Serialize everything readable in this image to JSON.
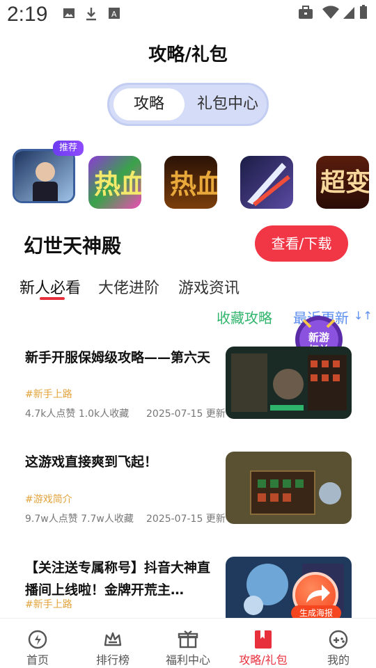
{
  "status": {
    "time": "2:19"
  },
  "header": {
    "title": "攻略/礼包"
  },
  "segment": {
    "active": "攻略",
    "inactive": "礼包中心"
  },
  "games": {
    "badge": "推荐",
    "icons": [
      {
        "name": "game-icon-1",
        "color1": "#2c4a7a",
        "color2": "#9fc3ee"
      },
      {
        "name": "game-icon-2",
        "color1": "#2a6b2f",
        "color2": "#e94fd0"
      },
      {
        "name": "game-icon-3",
        "color1": "#3a1a08",
        "color2": "#d89a2b"
      },
      {
        "name": "game-icon-4",
        "color1": "#2b2d5b",
        "color2": "#e6e6f2"
      },
      {
        "name": "game-icon-5",
        "color1": "#4b1a0c",
        "color2": "#f3c98f"
      }
    ]
  },
  "game": {
    "name": "幻世天神殿",
    "download": "查看/下载"
  },
  "tabs": [
    "新人必看",
    "大佬进阶",
    "游戏资讯"
  ],
  "sort": {
    "fav": "收藏攻略",
    "recent": "最近更新",
    "icon": "↓↑"
  },
  "promo": {
    "label": "新游\n权益"
  },
  "articles": [
    {
      "title": "新手开服保姆级攻略——第六天",
      "tag": "#新手上路",
      "meta": "4.7k人点赞 1.0k人收藏",
      "date": "2025-07-15 更新"
    },
    {
      "title": "这游戏直接爽到飞起！",
      "tag": "#游戏简介",
      "meta": "9.7w人点赞 7.7w人收藏",
      "date": "2025-07-15 更新"
    },
    {
      "title": "【关注送专属称号】抖音大神直播间上线啦！金牌开荒主…",
      "tag": "#新手上路",
      "meta": "",
      "date": ""
    }
  ],
  "float": {
    "label": "生成海报"
  },
  "nav": [
    {
      "label": "首页",
      "icon": "home-icon"
    },
    {
      "label": "排行榜",
      "icon": "ranking-icon"
    },
    {
      "label": "福利中心",
      "icon": "gift-icon"
    },
    {
      "label": "攻略/礼包",
      "icon": "guide-book-icon",
      "active": true
    },
    {
      "label": "我的",
      "icon": "profile-icon"
    }
  ],
  "colors": {
    "accent": "#e8303d",
    "green": "#2fb56b",
    "blue": "#5b8ef0"
  }
}
